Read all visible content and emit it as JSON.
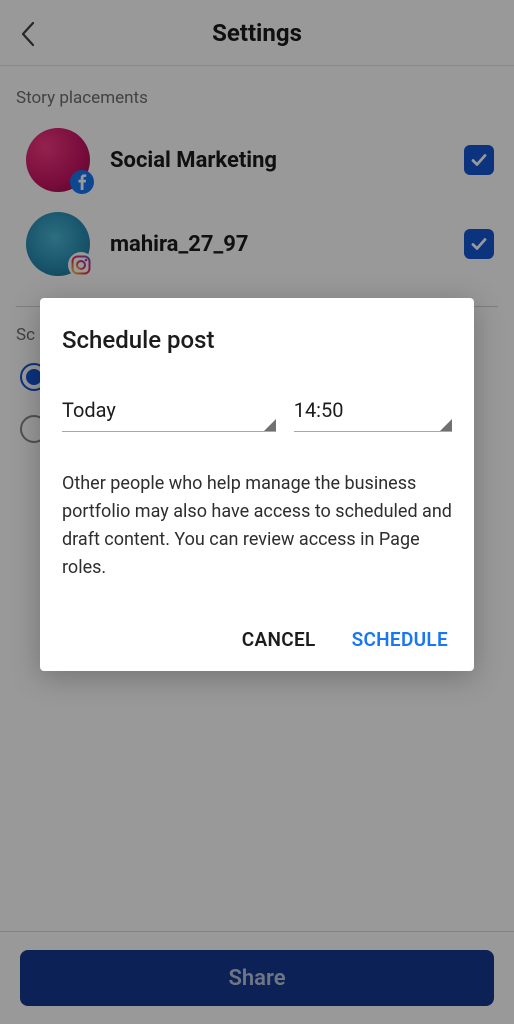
{
  "header": {
    "title": "Settings"
  },
  "story_placements": {
    "label": "Story placements",
    "items": [
      {
        "name": "Social Marketing",
        "platform": "facebook",
        "checked": true
      },
      {
        "name": "mahira_27_97",
        "platform": "instagram",
        "checked": true
      }
    ]
  },
  "scheduling": {
    "label": "Sc"
  },
  "share": {
    "label": "Share"
  },
  "modal": {
    "title": "Schedule post",
    "date": "Today",
    "time": "14:50",
    "description": "Other people who help manage the business portfolio may also have access to scheduled and draft content. You can review access in Page roles.",
    "cancel_label": "CANCEL",
    "schedule_label": "SCHEDULE"
  }
}
